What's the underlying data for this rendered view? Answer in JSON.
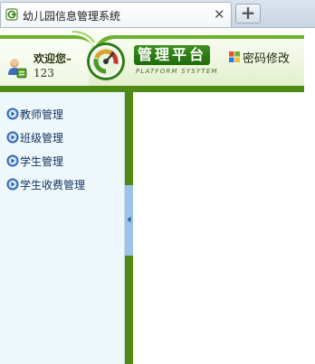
{
  "browser": {
    "tab_title": "幼儿园信息管理系统",
    "close_glyph": "✕",
    "newtab_glyph": "+"
  },
  "header": {
    "welcome": "欢迎您–",
    "username": "123",
    "platform_title": "管理平台",
    "platform_subtitle": "PLATFORM SYSYTEM",
    "password_link": "密码修改"
  },
  "menu": {
    "items": [
      {
        "label": "教师管理",
        "icon": "play-circle-icon"
      },
      {
        "label": "班级管理",
        "icon": "play-circle-icon"
      },
      {
        "label": "学生管理",
        "icon": "play-circle-icon"
      },
      {
        "label": "学生收费管理",
        "icon": "play-circle-icon"
      }
    ]
  },
  "colors": {
    "brand_green": "#4e8a14",
    "sidebar_bg": "#eef8fc",
    "menu_text": "#12315e",
    "splitter_handle": "#9cc3e8"
  }
}
